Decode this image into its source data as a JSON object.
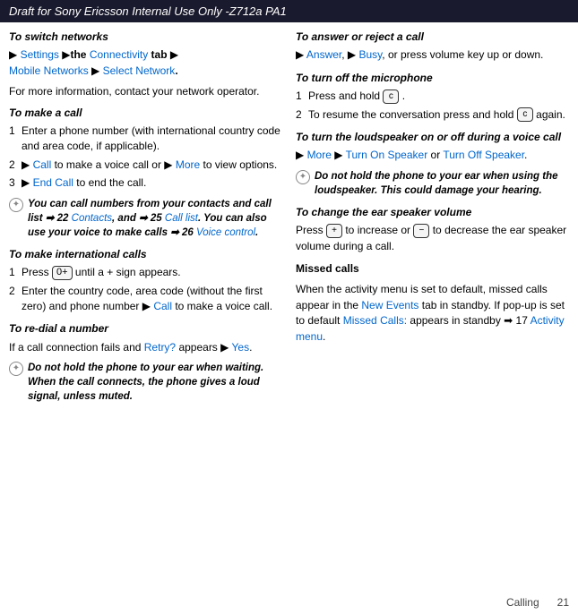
{
  "header": {
    "title": "Draft for Sony Ericsson Internal Use Only -Z712a PA1"
  },
  "footer": {
    "section": "Calling",
    "page": "21"
  },
  "left": {
    "switch_networks": {
      "title": "To switch networks",
      "body_arrow": "▶",
      "body1": "Settings",
      "body2": "▶the Connectivity tab ▶",
      "body3": "Mobile Networks ▶ Select Network.",
      "para": "For more information, contact your network operator."
    },
    "make_call": {
      "title": "To make a call",
      "items": [
        "Enter a phone number (with international country code and area code, if applicable).",
        "▶ Call to make a voice call or ▶ More to view options.",
        "▶ End Call to end the call."
      ]
    },
    "note1": "You can call numbers from your contacts and call list ➡ 22 Contacts, and ➡ 25 Call list. You can also use your voice to make calls ➡ 26 Voice control.",
    "international_calls": {
      "title": "To make international calls",
      "items": [
        "Press  until a + sign appears.",
        "Enter the country code, area code (without the first zero) and phone number ▶ Call to make a voice call."
      ]
    },
    "redial": {
      "title": "To re-dial a number",
      "body": "If a call connection fails and Retry? appears ▶ Yes."
    },
    "note2": "Do not hold the phone to your ear when waiting. When the call connects, the phone gives a loud signal, unless muted."
  },
  "right": {
    "answer_reject": {
      "title": "To answer or reject a call",
      "body": "▶ Answer, ▶ Busy, or press volume key up or down."
    },
    "turn_off_mic": {
      "title": "To turn off the microphone",
      "items": [
        "Press and hold  .",
        "To resume the conversation press and hold   again."
      ]
    },
    "loudspeaker": {
      "title": "To turn the loudspeaker on or off during a voice call",
      "body": "▶ More ▶ Turn On Speaker or Turn Off Speaker."
    },
    "note3": "Do not hold the phone to your ear when using the loudspeaker. This could damage your hearing.",
    "ear_speaker": {
      "title": "To change the ear speaker volume",
      "body_prefix": "Press",
      "body_middle": "to increase or",
      "body_suffix": "to decrease the ear speaker volume during a call."
    },
    "missed_calls": {
      "title": "Missed calls",
      "body": "When the activity menu is set to default, missed calls appear in the New Events tab in standby. If pop-up is set to default Missed Calls: appears in standby ➡ 17 Activity menu."
    }
  }
}
